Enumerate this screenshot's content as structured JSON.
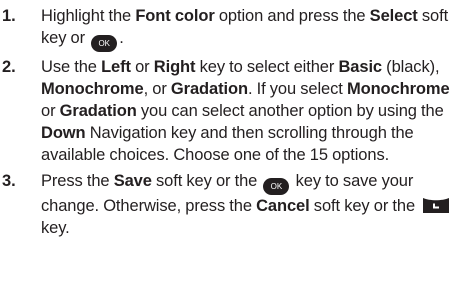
{
  "steps": [
    {
      "number": "1.",
      "t1": "Highlight the ",
      "b1": "Font color",
      "t2": " option and press the ",
      "b2": "Select",
      "t3": " soft key or ",
      "ok_icon_label": "OK",
      "t4": "."
    },
    {
      "number": "2.",
      "t1": "Use the ",
      "b1": "Left",
      "t2": " or ",
      "b2": "Right",
      "t3": " key to select either ",
      "b3": "Basic",
      "t4": " (black), ",
      "b4": "Monochrome",
      "t5": ", or ",
      "b5": "Gradation",
      "t6": ". If you select ",
      "b6": "Monochrome",
      "t7": " or ",
      "b7": "Gradation",
      "t8": " you can select another option by using the ",
      "b8": "Down",
      "t9": " Navigation key and then scrolling through the available choices. Choose one of the 15 options."
    },
    {
      "number": "3.",
      "t1": "Press the ",
      "b1": "Save",
      "t2": " soft key or the ",
      "ok_icon_label": "OK",
      "t3": " key to save your change. Otherwise, press the ",
      "b2": "Cancel",
      "t4": " soft key or the ",
      "t5": " key."
    }
  ],
  "icons": {
    "ok_key": "ok-key-icon",
    "clear_key": "clear-key-icon",
    "icon_fill": "#231f20",
    "icon_text": "#ffffff"
  },
  "colors": {
    "text": "#231f20",
    "background": "#ffffff"
  }
}
